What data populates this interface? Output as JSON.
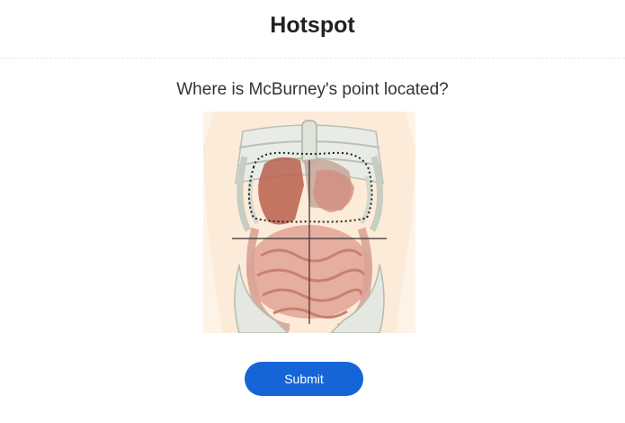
{
  "header": {
    "title": "Hotspot"
  },
  "question": {
    "text": "Where is McBurney's point located?"
  },
  "image": {
    "icon": "abdomen-anatomy-diagram"
  },
  "actions": {
    "submit_label": "Submit",
    "accent_color": "#1565d8"
  }
}
